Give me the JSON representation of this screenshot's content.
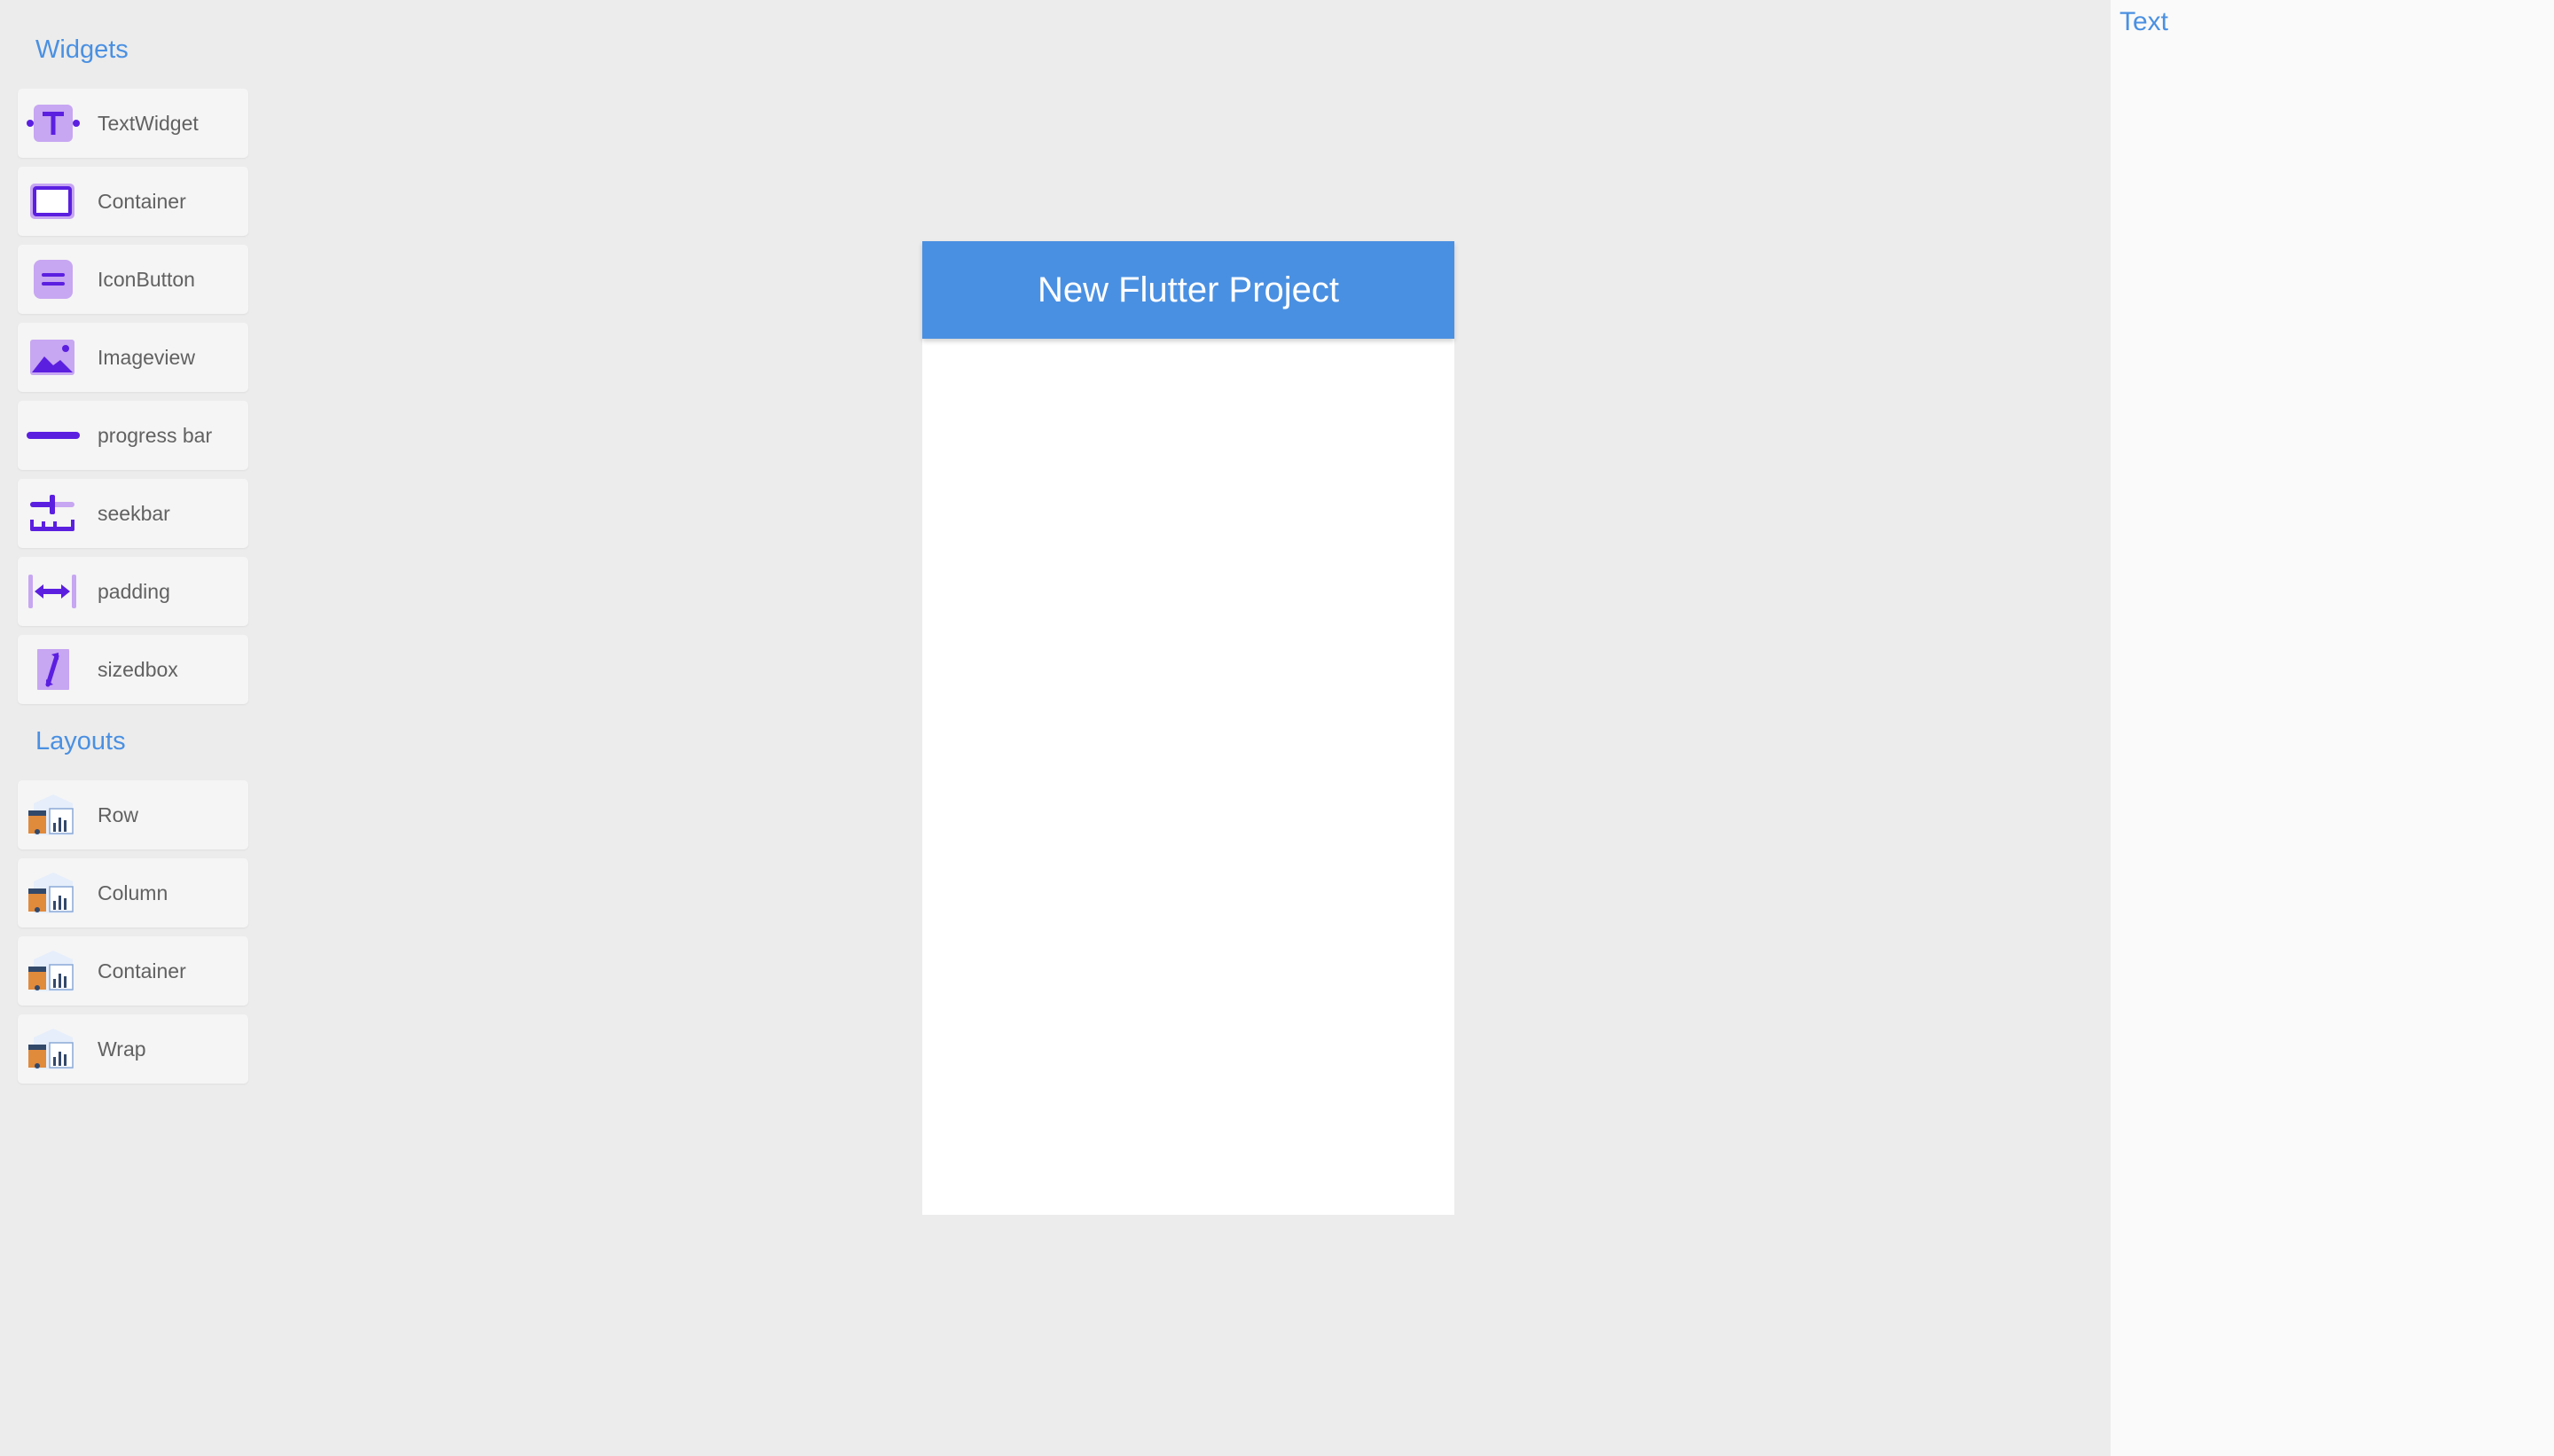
{
  "palette": {
    "widgets_title": "Widgets",
    "widgets": [
      {
        "label": "TextWidget",
        "icon": "text-widget-icon"
      },
      {
        "label": "Container",
        "icon": "container-icon"
      },
      {
        "label": "IconButton",
        "icon": "icon-button-icon"
      },
      {
        "label": "Imageview",
        "icon": "image-icon"
      },
      {
        "label": "progress bar",
        "icon": "progress-bar-icon"
      },
      {
        "label": "seekbar",
        "icon": "seekbar-icon"
      },
      {
        "label": "padding",
        "icon": "padding-icon"
      },
      {
        "label": "sizedbox",
        "icon": "sizedbox-icon"
      }
    ],
    "layouts_title": "Layouts",
    "layouts": [
      {
        "label": "Row",
        "icon": "layout-icon"
      },
      {
        "label": "Column",
        "icon": "layout-icon"
      },
      {
        "label": "Container",
        "icon": "layout-icon"
      },
      {
        "label": "Wrap",
        "icon": "layout-icon"
      }
    ]
  },
  "preview": {
    "appbar_title": "New Flutter Project"
  },
  "properties": {
    "title": "Text"
  },
  "colors": {
    "accent": "#4a90e2",
    "icon_primary": "#5b1fe0",
    "icon_light": "#c7a6f2",
    "background": "#ececec",
    "panel": "#fafafa"
  }
}
